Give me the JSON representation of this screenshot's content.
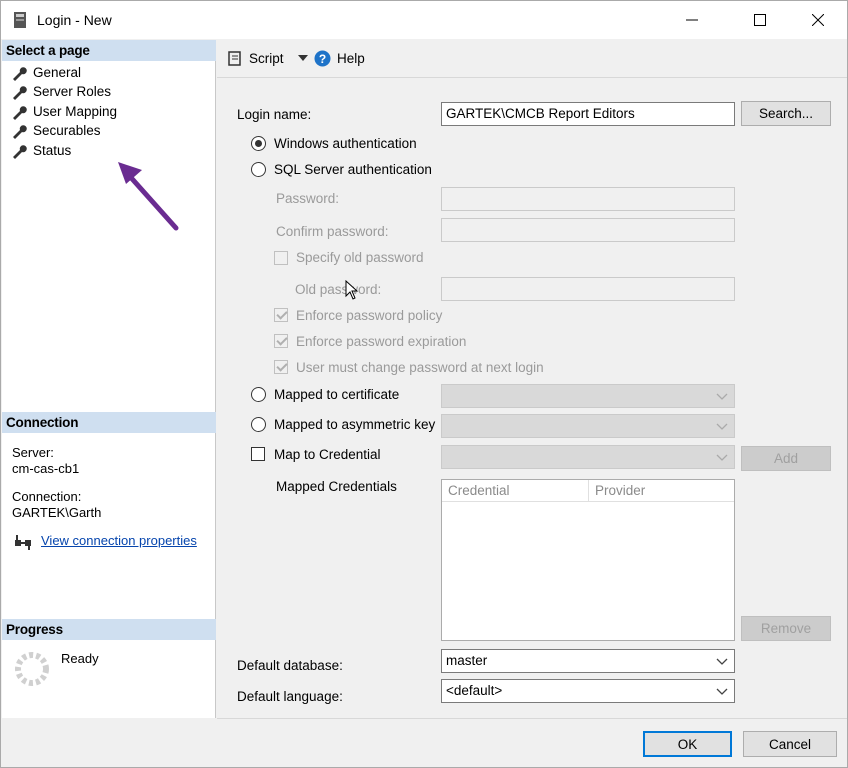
{
  "window": {
    "title": "Login - New"
  },
  "left": {
    "select_page_header": "Select a page",
    "pages": [
      {
        "label": "General"
      },
      {
        "label": "Server Roles"
      },
      {
        "label": "User Mapping"
      },
      {
        "label": "Securables"
      },
      {
        "label": "Status"
      }
    ],
    "connection_header": "Connection",
    "server_label": "Server:",
    "server_value": "cm-cas-cb1",
    "connection_label": "Connection:",
    "connection_value": "GARTEK\\Garth",
    "view_connection_link": "View connection properties",
    "progress_header": "Progress",
    "progress_status": "Ready"
  },
  "toolbar": {
    "script_label": "Script",
    "help_label": "Help"
  },
  "form": {
    "login_name_label": "Login name:",
    "login_name_value": "GARTEK\\CMCB Report Editors",
    "search_button": "Search...",
    "windows_auth_label": "Windows authentication",
    "sql_auth_label": "SQL Server authentication",
    "password_label": "Password:",
    "confirm_password_label": "Confirm password:",
    "specify_old_password_label": "Specify old password",
    "old_password_label": "Old password:",
    "enforce_policy_label": "Enforce password policy",
    "enforce_expiration_label": "Enforce password expiration",
    "must_change_label": "User must change password at next login",
    "mapped_cert_label": "Mapped to certificate",
    "mapped_asym_label": "Mapped to asymmetric key",
    "map_credential_label": "Map to Credential",
    "add_button": "Add",
    "mapped_credentials_label": "Mapped Credentials",
    "credentials_columns": [
      "Credential",
      "Provider"
    ],
    "remove_button": "Remove",
    "default_database_label": "Default database:",
    "default_database_value": "master",
    "default_language_label": "Default language:",
    "default_language_value": "<default>"
  },
  "footer": {
    "ok_button": "OK",
    "cancel_button": "Cancel"
  },
  "colors": {
    "section_header_bg": "#cfdff0",
    "link": "#0645ad",
    "annotation_arrow": "#6a2c91",
    "ok_border": "#0078d7"
  }
}
